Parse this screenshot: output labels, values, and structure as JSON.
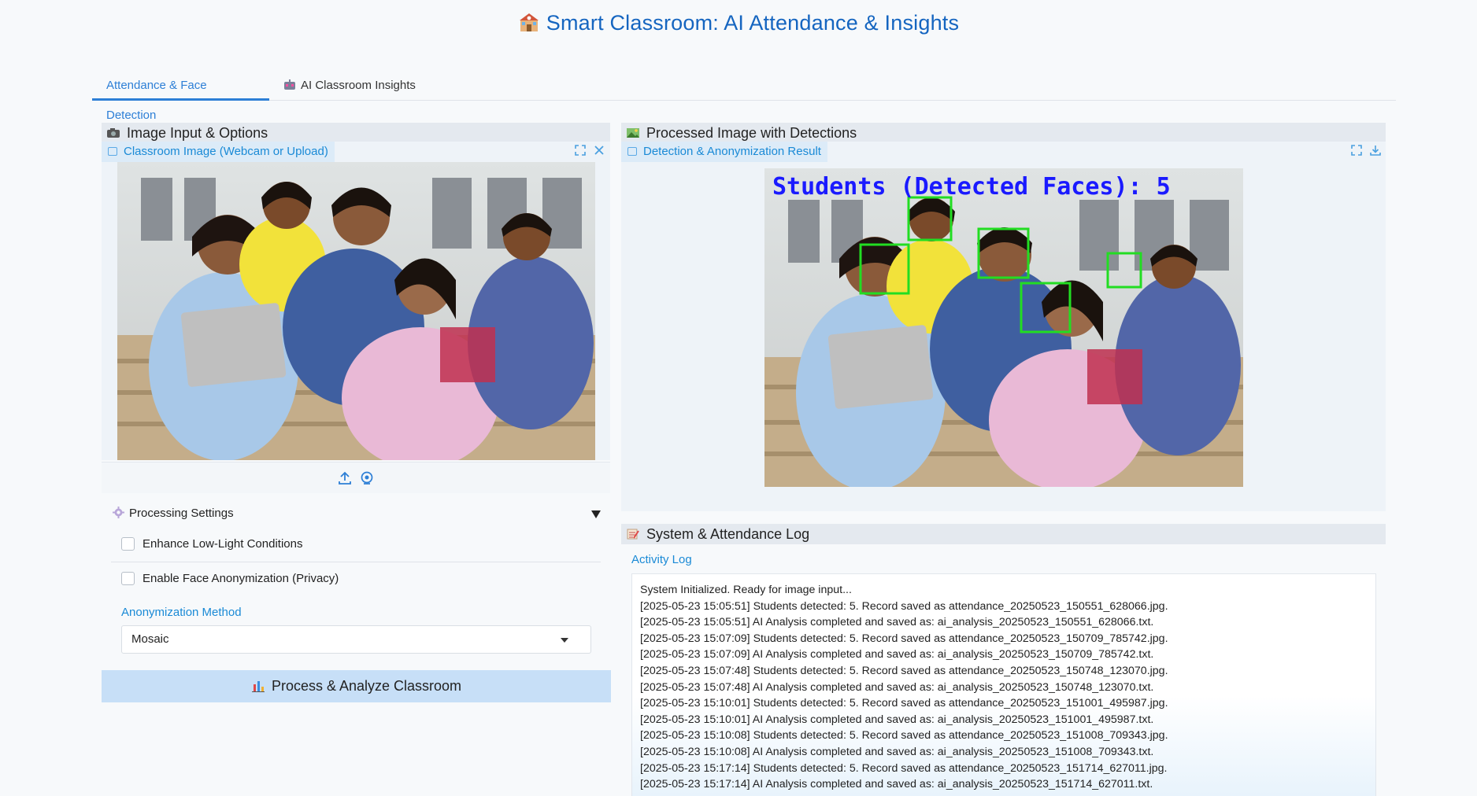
{
  "app": {
    "title": "Smart Classroom: AI Attendance & Insights"
  },
  "tabs": [
    {
      "label": "Attendance & Face Detection",
      "active": true
    },
    {
      "label": "AI Classroom Insights",
      "active": false
    }
  ],
  "left_panel": {
    "title": "Image Input & Options",
    "image_label": "Classroom Image (Webcam or Upload)",
    "fullscreen_icon": "fullscreen-icon",
    "clear_icon": "close-icon",
    "source_icons": [
      "upload-icon",
      "webcam-icon"
    ],
    "settings": {
      "title": "Processing Settings",
      "expanded": true,
      "options": [
        {
          "label": "Enhance Low-Light Conditions",
          "checked": false
        },
        {
          "label": "Enable Face Anonymization (Privacy)",
          "checked": false
        }
      ],
      "method_label": "Anonymization Method",
      "method_value": "Mosaic"
    },
    "process_button": "Process & Analyze Classroom"
  },
  "right_panel": {
    "title": "Processed Image with Detections",
    "image_label": "Detection & Anonymization Result",
    "overlay_text": "Students (Detected Faces): 5",
    "fullscreen_icon": "fullscreen-icon",
    "download_icon": "download-icon"
  },
  "log_panel": {
    "title": "System & Attendance Log",
    "label": "Activity Log",
    "lines": [
      "System Initialized. Ready for image input...",
      "[2025-05-23 15:05:51] Students detected: 5. Record saved as attendance_20250523_150551_628066.jpg.",
      "[2025-05-23 15:05:51] AI Analysis completed and saved as: ai_analysis_20250523_150551_628066.txt.",
      "[2025-05-23 15:07:09] Students detected: 5. Record saved as attendance_20250523_150709_785742.jpg.",
      "[2025-05-23 15:07:09] AI Analysis completed and saved as: ai_analysis_20250523_150709_785742.txt.",
      "[2025-05-23 15:07:48] Students detected: 5. Record saved as attendance_20250523_150748_123070.jpg.",
      "[2025-05-23 15:07:48] AI Analysis completed and saved as: ai_analysis_20250523_150748_123070.txt.",
      "[2025-05-23 15:10:01] Students detected: 5. Record saved as attendance_20250523_151001_495987.jpg.",
      "[2025-05-23 15:10:01] AI Analysis completed and saved as: ai_analysis_20250523_151001_495987.txt.",
      "[2025-05-23 15:10:08] Students detected: 5. Record saved as attendance_20250523_151008_709343.jpg.",
      "[2025-05-23 15:10:08] AI Analysis completed and saved as: ai_analysis_20250523_151008_709343.txt.",
      "[2025-05-23 15:17:14] Students detected: 5. Record saved as attendance_20250523_151714_627011.jpg.",
      "[2025-05-23 15:17:14] AI Analysis completed and saved as: ai_analysis_20250523_151714_627011.txt."
    ]
  },
  "colors": {
    "accent": "#2d7fd6",
    "label_blue": "#1a8ad6",
    "button_bg": "#c7dff7",
    "face_box": "#22dd22",
    "overlay_text": "#1a1aff"
  }
}
